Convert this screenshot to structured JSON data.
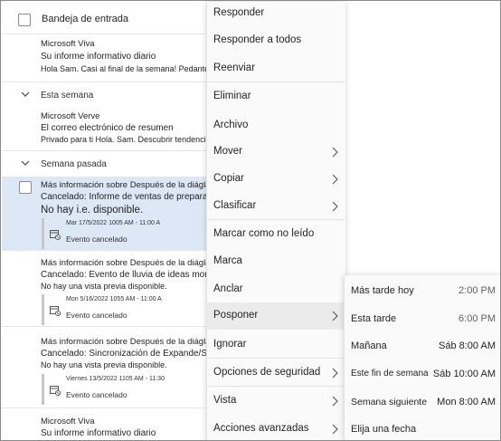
{
  "list": {
    "header_title": "Bandeja de entrada",
    "groups": [
      {
        "label": "Esta semana"
      },
      {
        "label": "Semana pasada"
      }
    ],
    "items": [
      {
        "sender": "Microsoft Viva",
        "subject": "Su informe informativo diario",
        "preview": "Hola Sam. Casi al final de la semana! Pedante"
      },
      {
        "sender": "Microsoft Verve",
        "subject": "El correo electrónico de resumen",
        "preview": "Privado para ti Hola. Sam. Descubrir tendencias en"
      },
      {
        "sender": "Más información sobre Después de la diágla",
        "subject": "Cancelado: Informe de ventas de preparación",
        "preview": "No hay i.e. disponible.",
        "event_when": "Mar 17/5/2022 1005 AM - 11:00 A",
        "event_status": "Evento cancelado"
      },
      {
        "sender": "Más información sobre Después de la diágla",
        "subject": "Cancelado: Evento de lluvia de ideas moral",
        "preview": "No hay una vista previa disponible.",
        "event_when": "Mon 5/16/2022 1055 AM - 11:00 A",
        "event_status": "Evento cancelado"
      },
      {
        "sender": "Más información sobre Después de la diágla",
        "subject": "Cancelado: Sincronización de Expande/Sam",
        "preview": "No hay una vista previa disponible.",
        "event_when": "Viernes 13/5/2022 1105 AM - 11:30",
        "event_status": "Evento cancelado"
      },
      {
        "sender": "Microsoft Viva",
        "subject": "Su informe informativo diario"
      }
    ]
  },
  "menu": {
    "items": [
      {
        "label": "Responder"
      },
      {
        "label": "Responder a todos"
      },
      {
        "label": "Reenviar"
      },
      {
        "label": "Eliminar"
      },
      {
        "label": "Archivo"
      },
      {
        "label": "Mover"
      },
      {
        "label": "Copiar"
      },
      {
        "label": "Clasificar"
      },
      {
        "label": "Marcar como no leído"
      },
      {
        "label": "Marca"
      },
      {
        "label": "Anclar"
      },
      {
        "label": "Posponer"
      },
      {
        "label": "Ignorar"
      },
      {
        "label": "Opciones de seguridad"
      },
      {
        "label": "Vista"
      },
      {
        "label": "Acciones avanzadas"
      }
    ]
  },
  "submenu": {
    "items": [
      {
        "label": "Más tarde hoy",
        "time": "2:00 PM"
      },
      {
        "label": "Esta tarde",
        "time": "6:00 PM"
      },
      {
        "label": "Mañana",
        "time": "Sáb 8:00 AM"
      },
      {
        "label": "Este fin de semana",
        "time": "Sáb 10:00 AM"
      },
      {
        "label": "Semana siguiente",
        "time": "Mon 8:00 AM"
      },
      {
        "label": "Elija una fecha"
      }
    ]
  },
  "colors": {
    "selected_row": "#dde8f6",
    "menu_bg": "#fafafa",
    "hover": "#ebebeb"
  }
}
